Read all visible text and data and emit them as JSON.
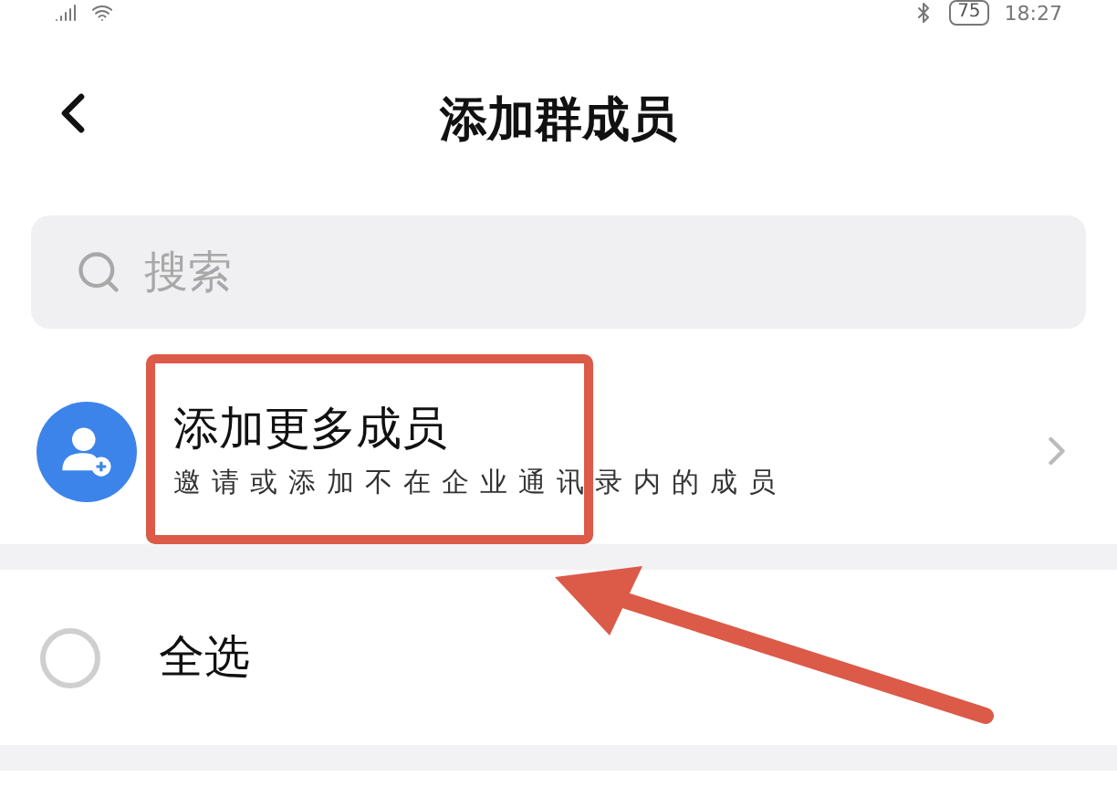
{
  "status_bar": {
    "battery": "75",
    "time": "18:27"
  },
  "header": {
    "title": "添加群成员"
  },
  "search": {
    "placeholder": "搜索"
  },
  "add_more": {
    "title": "添加更多成员",
    "subtitle": "邀请或添加不在企业通讯录内的成员"
  },
  "select_all": {
    "label": "全选",
    "selected": false
  }
}
